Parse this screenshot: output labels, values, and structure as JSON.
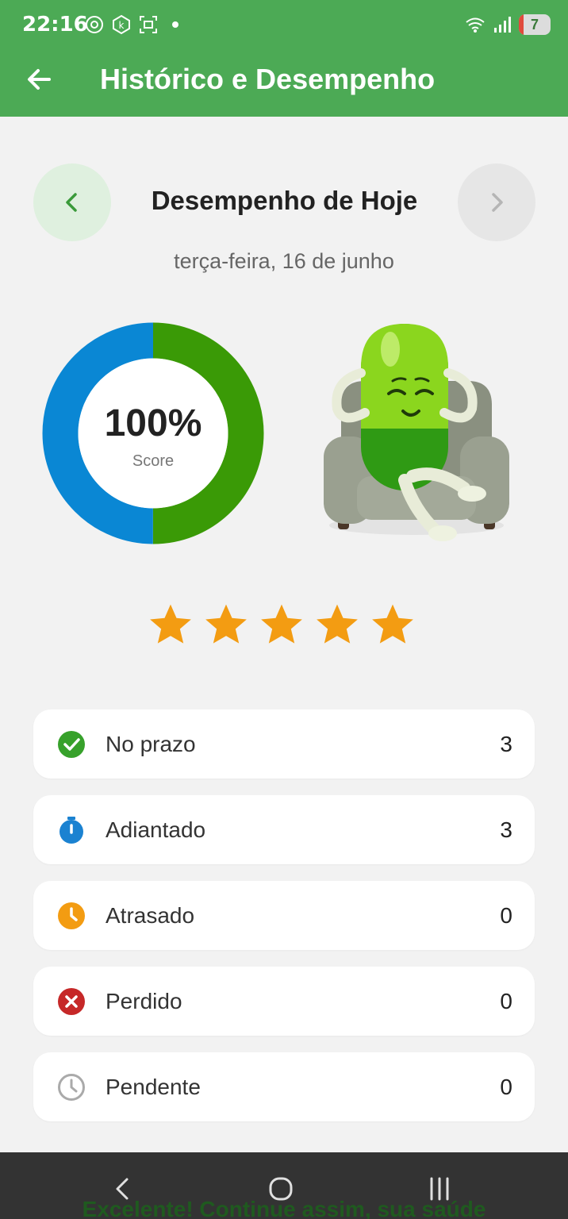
{
  "status_bar": {
    "time": "22:16",
    "battery_level": "7"
  },
  "header": {
    "title": "Histórico e Desempenho"
  },
  "day_nav": {
    "title": "Desempenho de Hoje",
    "date": "terça-feira, 16 de junho"
  },
  "score": {
    "value_text": "100%",
    "label": "Score",
    "segments": [
      {
        "name": "green",
        "fraction": 0.5,
        "color": "#3a9a06"
      },
      {
        "name": "blue",
        "fraction": 0.5,
        "color": "#0a87d4"
      }
    ]
  },
  "rating": {
    "stars_filled": 5,
    "stars_total": 5,
    "color": "#f39c12"
  },
  "stats": [
    {
      "label": "No prazo",
      "count": "3",
      "icon": "check-circle-icon",
      "color": "#37a12b"
    },
    {
      "label": "Adiantado",
      "count": "3",
      "icon": "stopwatch-icon",
      "color": "#1b82d1"
    },
    {
      "label": "Atrasado",
      "count": "0",
      "icon": "clock-icon",
      "color": "#f39c12"
    },
    {
      "label": "Perdido",
      "count": "0",
      "icon": "x-circle-icon",
      "color": "#c62828"
    },
    {
      "label": "Pendente",
      "count": "0",
      "icon": "clock-outline-icon",
      "color": "#aaaaaa"
    }
  ],
  "bottom": {
    "message": "Excelente! Continue assim, sua saúde"
  },
  "colors": {
    "header": "#4caa55",
    "accent_green": "#3a9a06",
    "background": "#f2f2f2"
  }
}
